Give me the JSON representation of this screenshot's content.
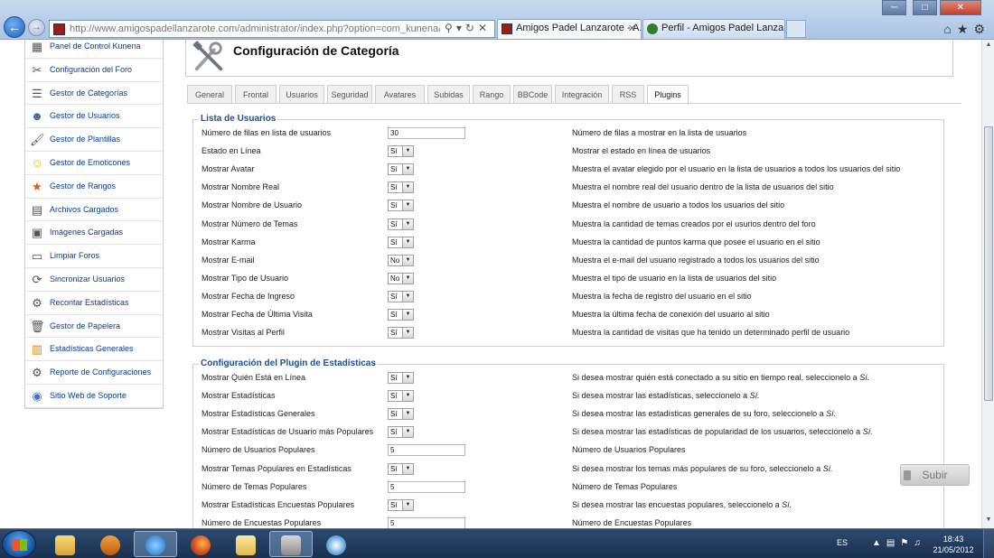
{
  "browser": {
    "url": "http://www.amigospadellanzarote.com/administrator/index.php?option=com_kunena&task=sh",
    "tabs": [
      {
        "label": "Amigos Padel Lanzarote - A...",
        "active": true
      },
      {
        "label": "Perfil - Amigos Padel Lanzarote",
        "active": false
      }
    ]
  },
  "sidebar": {
    "items": [
      {
        "label": "Panel de Control Kunena",
        "icon": "control-panel-icon"
      },
      {
        "label": "Configuración del Foro",
        "icon": "tools-icon"
      },
      {
        "label": "Gestor de Categorías",
        "icon": "categories-icon"
      },
      {
        "label": "Gestor de Usuarios",
        "icon": "users-icon"
      },
      {
        "label": "Gestor de Plantillas",
        "icon": "templates-icon"
      },
      {
        "label": "Gestor de Emoticones",
        "icon": "smiley-icon"
      },
      {
        "label": "Gestor de Rangos",
        "icon": "star-icon"
      },
      {
        "label": "Archivos Cargados",
        "icon": "files-icon"
      },
      {
        "label": "Imágenes Cargadas",
        "icon": "images-icon"
      },
      {
        "label": "Limpiar Foros",
        "icon": "clean-icon"
      },
      {
        "label": "Sincronizar Usuarios",
        "icon": "sync-icon"
      },
      {
        "label": "Recontar Estadísticas",
        "icon": "recount-icon"
      },
      {
        "label": "Gestor de Papelera",
        "icon": "trash-icon"
      },
      {
        "label": "Estadísticas Generales",
        "icon": "chart-icon"
      },
      {
        "label": "Reporte de Configuraciones",
        "icon": "report-icon"
      },
      {
        "label": "Sitio Web de Soporte",
        "icon": "globe-icon"
      }
    ]
  },
  "header": {
    "title": "Configuración de Categoría"
  },
  "tabs": [
    "General",
    "Frontal",
    "Usuarios",
    "Seguridad",
    "Avatares",
    "Subidas",
    "Rango",
    "BBCode",
    "Integración",
    "RSS",
    "Plugins"
  ],
  "active_tab": "Plugins",
  "section1": {
    "legend": "Lista de Usuarios",
    "rows": [
      {
        "label": "Número de filas en lista de usuarios",
        "type": "text",
        "value": "30",
        "desc": "Número de filas a mostrar en la lista de usuarios"
      },
      {
        "label": "Estado en Línea",
        "type": "select",
        "value": "Sí",
        "desc": "Mostrar el estado en línea de usuarios"
      },
      {
        "label": "Mostrar Avatar",
        "type": "select",
        "value": "Sí",
        "desc": "Muestra el avatar elegido por el usuario en la lista de usuarios a todos los usuarios del sitio"
      },
      {
        "label": "Mostrar Nombre Real",
        "type": "select",
        "value": "Sí",
        "desc": "Muestra el nombre real del usuario dentro de la lista de usuarios del sitio"
      },
      {
        "label": "Mostrar Nombre de Usuario",
        "type": "select",
        "value": "Sí",
        "desc": "Muestra el nombre de usuario a todos los usuarios del sitio"
      },
      {
        "label": "Mostrar Número de Temas",
        "type": "select",
        "value": "Sí",
        "desc": "Muestra la cantidad de temas creados por el usurios dentro del foro"
      },
      {
        "label": "Mostrar Karma",
        "type": "select",
        "value": "Sí",
        "desc": "Muestra la cantidad de puntos karma que posee el usuario en el sitio"
      },
      {
        "label": "Mostrar E-mail",
        "type": "select",
        "value": "No",
        "desc": "Muestra el e-mail del usuario registrado a todos los usuarios del sitio"
      },
      {
        "label": "Mostrar Tipo de Usuario",
        "type": "select",
        "value": "No",
        "desc": "Muestra el tipo de usuario en la lista de usuarios del sitio"
      },
      {
        "label": "Mostrar Fecha de Ingreso",
        "type": "select",
        "value": "Sí",
        "desc": "Muestra la fecha de registro del usuario en el sitio"
      },
      {
        "label": "Mostrar Fecha de Última Visita",
        "type": "select",
        "value": "Sí",
        "desc": "Muestra la última fecha de conexión del usuario al sitio"
      },
      {
        "label": "Mostrar Visitas al Perfil",
        "type": "select",
        "value": "Sí",
        "desc": "Muestra la cantidad de visitas que ha tenido un determinado perfil de usuario"
      }
    ]
  },
  "section2": {
    "legend": "Configuración del Plugin de Estadísticas",
    "rows": [
      {
        "label": "Mostrar Quién Está en Línea",
        "type": "select",
        "value": "Sí",
        "desc": "Si desea mostrar quién está conectado a su sitio en tiempo real, seleccionelo a ",
        "em": "Sí."
      },
      {
        "label": "Mostrar Estadísticas",
        "type": "select",
        "value": "Sí",
        "desc": "Si desea mostrar las estadísticas, seleccionelo a ",
        "em": "Sí."
      },
      {
        "label": "Mostrar Estadísticas Generales",
        "type": "select",
        "value": "Sí",
        "desc": "Si desea mostrar las estadísticas generales de su foro, seleccionelo a ",
        "em": "Sí."
      },
      {
        "label": "Mostrar Estadísticas de Usuario más Populares",
        "type": "select",
        "value": "Sí",
        "desc": "Si desea mostrar las estadísticas de popularidad de los usuarios, seleccionelo a ",
        "em": "Sí."
      },
      {
        "label": "Número de Usuarios Populares",
        "type": "text",
        "value": "5",
        "desc": "Número de Usuarios Populares"
      },
      {
        "label": "Mostrar Temas Populares en Estadísticas",
        "type": "select",
        "value": "Sí",
        "desc": "Si desea mostrar los temas más populares de su foro, seleccionelo a ",
        "em": "Sí."
      },
      {
        "label": "Número de Temas Populares",
        "type": "text",
        "value": "5",
        "desc": "Número de Temas Populares"
      },
      {
        "label": "Mostrar Estadísticas Encuestas Populares",
        "type": "select",
        "value": "Sí",
        "desc": "Si desea mostrar las encuestas populares, seleccionelo a ",
        "em": "Sí."
      },
      {
        "label": "Número de Encuestas Populares",
        "type": "text",
        "value": "5",
        "desc": "Número de Encuestas Populares"
      }
    ]
  },
  "subir_label": "Subir",
  "tray": {
    "lang": "ES",
    "time": "18:43",
    "date": "21/05/2012"
  }
}
